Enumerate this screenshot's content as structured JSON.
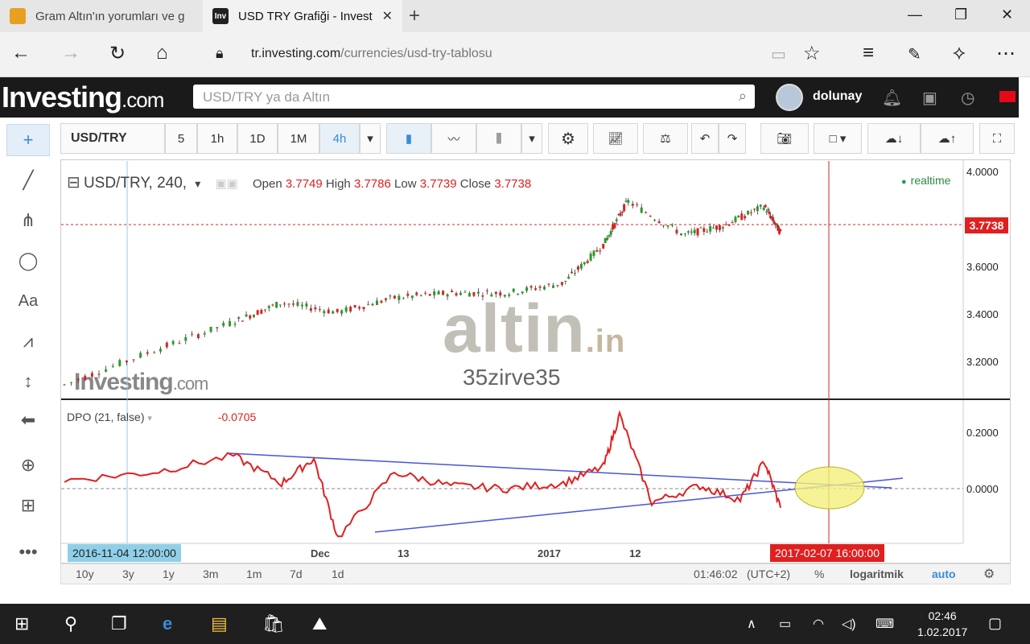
{
  "browser": {
    "tabs": [
      {
        "title": "Gram Altın'ın yorumları ve g",
        "favicon_color": "#e8a020"
      },
      {
        "title": "USD TRY Grafiği - Invest",
        "favicon_text": "Inv"
      }
    ],
    "url_host": "tr.investing.com",
    "url_path": "/currencies/usd-try-tablosu"
  },
  "site": {
    "logo_main": "Investing",
    "logo_tld": ".com",
    "search_placeholder": "USD/TRY ya da Altın",
    "username": "dolunay"
  },
  "toolbar": {
    "symbol": "USD/TRY",
    "intervals": [
      "5",
      "1h",
      "1D",
      "1M",
      "4h"
    ],
    "active_interval": "4h"
  },
  "chart_data": [
    {
      "type": "candlestick",
      "symbol_label": "USD/TRY, 240,",
      "ohlc": {
        "open_label": "Open",
        "open": "3.7749",
        "high_label": "High",
        "high": "3.7786",
        "low_label": "Low",
        "low": "3.7739",
        "close_label": "Close",
        "close": "3.7738"
      },
      "status": "realtime",
      "y_ticks": [
        "4.0000",
        "3.6000",
        "3.4000",
        "3.2000"
      ],
      "current_price": "3.7738",
      "ylim": [
        3.1,
        4.05
      ],
      "x": [
        "2016-11-04",
        "2016-11-15",
        "2016-11-25",
        "2016-12-01",
        "2016-12-08",
        "2016-12-15",
        "2016-12-22",
        "2016-12-29",
        "2017-01-05",
        "2017-01-10",
        "2017-01-13",
        "2017-01-20",
        "2017-01-25",
        "2017-01-30",
        "2017-02-01"
      ],
      "values": [
        3.14,
        3.28,
        3.4,
        3.48,
        3.44,
        3.5,
        3.52,
        3.52,
        3.56,
        3.72,
        3.9,
        3.76,
        3.8,
        3.88,
        3.77
      ]
    },
    {
      "type": "line",
      "indicator_label": "DPO (21, false)",
      "indicator_value": "-0.0705",
      "y_ticks": [
        "0.2000",
        "0.0000"
      ],
      "ylim": [
        -0.2,
        0.3
      ],
      "x": [
        "2016-11-04",
        "2016-11-15",
        "2016-11-25",
        "2016-12-01",
        "2016-12-05",
        "2016-12-08",
        "2016-12-15",
        "2016-12-22",
        "2016-12-29",
        "2017-01-05",
        "2017-01-10",
        "2017-01-12",
        "2017-01-16",
        "2017-01-22",
        "2017-01-27",
        "2017-01-30",
        "2017-02-01"
      ],
      "values": [
        0.03,
        0.06,
        0.12,
        0.02,
        0.11,
        -0.18,
        0.06,
        0.01,
        0.0,
        0.02,
        0.08,
        0.27,
        -0.05,
        0.01,
        -0.04,
        0.1,
        -0.07
      ],
      "trendlines": 2
    }
  ],
  "x_axis": {
    "start_tag": "2016-11-04 12:00:00",
    "labels": [
      "Dec",
      "13",
      "2017",
      "12"
    ],
    "cursor_tag": "2017-02-07 16:00:00"
  },
  "ranges": [
    "10y",
    "3y",
    "1y",
    "3m",
    "1m",
    "7d",
    "1d"
  ],
  "footer": {
    "time": "01:46:02",
    "tz": "(UTC+2)",
    "percent": "%",
    "log": "logaritmik",
    "auto": "auto"
  },
  "watermarks": {
    "brand": "altin",
    "brand_tld": ".in",
    "user": "35zirve35",
    "investing": "Investing",
    "investing_tld": ".com"
  },
  "taskbar": {
    "time": "02:46",
    "date": "1.02.2017"
  },
  "colors": {
    "price_line": "#e0201f",
    "cursor_line": "#c62828",
    "trendline": "#4a55d8",
    "ellipse": "#f4f07c",
    "accent": "#3a8bd8"
  }
}
